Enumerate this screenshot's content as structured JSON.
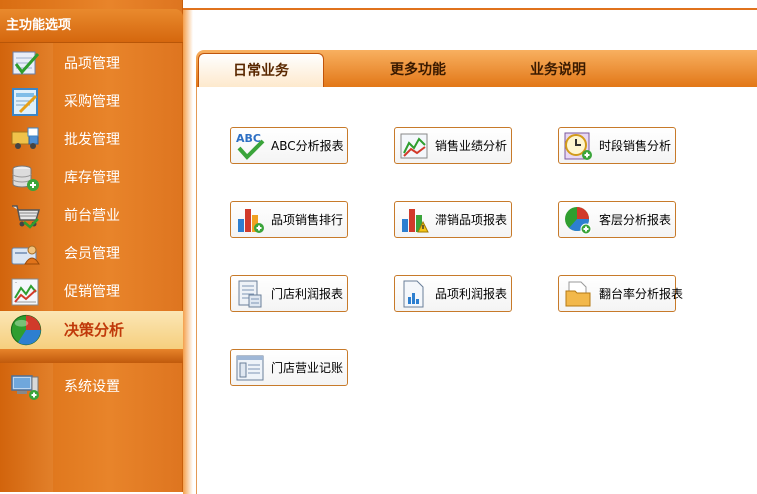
{
  "sidebar": {
    "header": "主功能选项",
    "items": [
      {
        "label": "品项管理",
        "icon": "checklist-icon"
      },
      {
        "label": "采购管理",
        "icon": "purchase-form-icon"
      },
      {
        "label": "批发管理",
        "icon": "wholesale-truck-icon"
      },
      {
        "label": "库存管理",
        "icon": "database-add-icon"
      },
      {
        "label": "前台营业",
        "icon": "shopping-cart-icon"
      },
      {
        "label": "会员管理",
        "icon": "member-card-icon"
      },
      {
        "label": "促销管理",
        "icon": "line-chart-icon"
      },
      {
        "label": "决策分析",
        "icon": "pie-chart-icon",
        "active": true
      },
      {
        "label": "系统设置",
        "icon": "computer-settings-icon"
      }
    ]
  },
  "tabs": [
    {
      "label": "日常业务",
      "active": true
    },
    {
      "label": "更多功能",
      "active": false
    },
    {
      "label": "业务说明",
      "active": false
    }
  ],
  "functions": [
    {
      "label": "ABC分析报表",
      "icon": "abc-check-icon"
    },
    {
      "label": "销售业绩分析",
      "icon": "sales-trend-icon"
    },
    {
      "label": "时段销售分析",
      "icon": "clock-report-icon"
    },
    {
      "label": "品项销售排行",
      "icon": "bar-chart-add-icon"
    },
    {
      "label": "滞销品项报表",
      "icon": "bar-chart-warning-icon"
    },
    {
      "label": "客层分析报表",
      "icon": "pie-chart-add-icon"
    },
    {
      "label": "门店利润报表",
      "icon": "document-list-icon"
    },
    {
      "label": "品项利润报表",
      "icon": "document-chart-icon"
    },
    {
      "label": "翻台率分析报表",
      "icon": "folder-icon"
    },
    {
      "label": "门店营业记账",
      "icon": "ledger-window-icon"
    }
  ],
  "colors": {
    "sidebar": "#e07a22",
    "active_item": "#f9dc9a",
    "accent": "#e0721c",
    "button_border": "#c77a2a"
  }
}
